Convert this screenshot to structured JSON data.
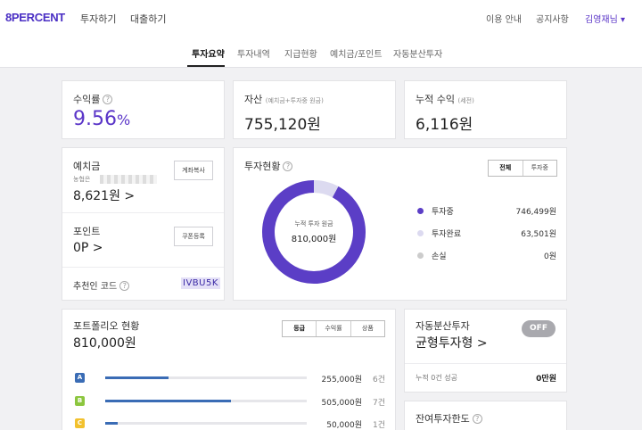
{
  "header": {
    "logo": "8PERCENT",
    "nav": [
      "투자하기",
      "대출하기"
    ],
    "right": [
      "이용 안내",
      "공지사항"
    ],
    "user": "김영재님 ▾"
  },
  "tabs": [
    "투자요약",
    "투자내역",
    "지급현황",
    "예치금/포인트",
    "자동분산투자"
  ],
  "summary": {
    "return_label": "수익률",
    "return_value": "9.56",
    "return_unit": "%",
    "assets_label": "자산",
    "assets_sub": "(예치금+투자중 원금)",
    "assets_value": "755,120원",
    "cum_label": "누적 수익",
    "cum_sub": "(세전)",
    "cum_value": "6,116원"
  },
  "deposit": {
    "label": "예치금",
    "bank_prefix": "농협은",
    "value": "8,621원 >",
    "copy_button": "계좌복사",
    "points_label": "포인트",
    "points_value": "0P >",
    "coupon_button": "쿠폰등록",
    "referral_label": "추천인 코드",
    "referral_code": "IVBU5K"
  },
  "investment": {
    "title": "투자현황",
    "filters": [
      "전체",
      "투자중"
    ],
    "center_label": "누적 투자 원금",
    "center_value": "810,000원",
    "legend": [
      {
        "label": "투자중",
        "value": "746,499원",
        "color": "#5b3ec6"
      },
      {
        "label": "투자완료",
        "value": "63,501원",
        "color": "#dcdaf0"
      },
      {
        "label": "손실",
        "value": "0원",
        "color": "#cccccc"
      }
    ]
  },
  "chart_data": {
    "type": "pie",
    "categories": [
      "투자중",
      "투자완료",
      "손실"
    ],
    "values": [
      746499,
      63501,
      0
    ],
    "colors": [
      "#5b3ec6",
      "#dcdaf0",
      "#cccccc"
    ]
  },
  "portfolio": {
    "title": "포트폴리오 현황",
    "total": "810,000원",
    "filters": [
      "등급",
      "수익률",
      "상품"
    ],
    "rows": [
      {
        "grade": "A",
        "color": "#3a6cb5",
        "ratio": 0.3148,
        "amount": "255,000원",
        "count": "6건"
      },
      {
        "grade": "B",
        "color": "#8cc63f",
        "ratio": 0.6235,
        "amount": "505,000원",
        "count": "7건"
      },
      {
        "grade": "C",
        "color": "#f2c12e",
        "ratio": 0.0617,
        "amount": "50,000원",
        "count": "1건"
      }
    ]
  },
  "auto": {
    "title": "자동분산투자",
    "toggle": "OFF",
    "strategy": "균형투자형 >",
    "cum_label": "누적 0건 성공",
    "cum_value": "0만원"
  },
  "limit": {
    "title": "잔여투자한도"
  }
}
